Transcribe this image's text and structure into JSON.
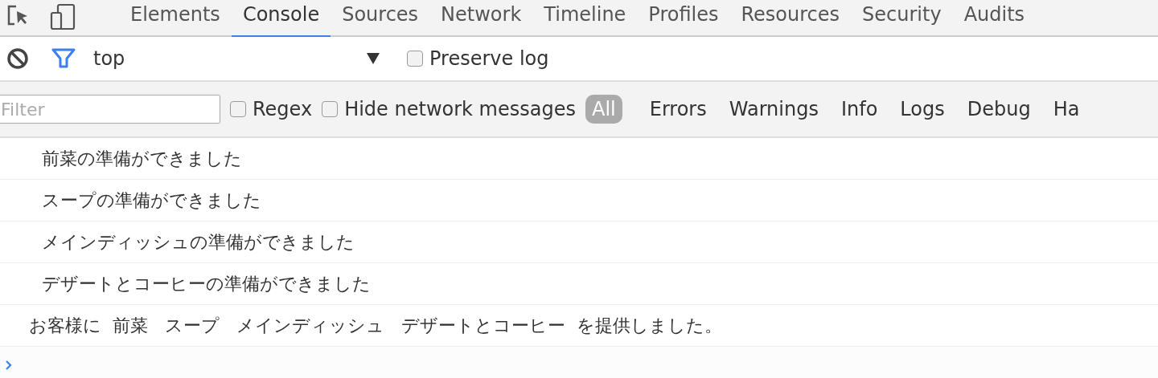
{
  "tabs": [
    {
      "label": "Elements",
      "selected": false
    },
    {
      "label": "Console",
      "selected": true
    },
    {
      "label": "Sources",
      "selected": false
    },
    {
      "label": "Network",
      "selected": false
    },
    {
      "label": "Timeline",
      "selected": false
    },
    {
      "label": "Profiles",
      "selected": false
    },
    {
      "label": "Resources",
      "selected": false
    },
    {
      "label": "Security",
      "selected": false
    },
    {
      "label": "Audits",
      "selected": false
    }
  ],
  "toolbar": {
    "context": "top",
    "preserve_log": {
      "label": "Preserve log",
      "checked": false
    }
  },
  "filter_bar": {
    "placeholder": "Filter",
    "regex": {
      "label": "Regex",
      "checked": false
    },
    "hide_network": {
      "label": "Hide network messages",
      "checked": false
    },
    "levels": [
      {
        "label": "All",
        "selected": true
      },
      {
        "label": "Errors",
        "selected": false
      },
      {
        "label": "Warnings",
        "selected": false
      },
      {
        "label": "Info",
        "selected": false
      },
      {
        "label": "Logs",
        "selected": false
      },
      {
        "label": "Debug",
        "selected": false
      },
      {
        "label": "Ha",
        "selected": false
      }
    ]
  },
  "messages": [
    {
      "text": "前菜の準備ができました",
      "kind": "indented"
    },
    {
      "text": "スープの準備ができました",
      "kind": "indented"
    },
    {
      "text": "メインディッシュの準備ができました",
      "kind": "indented"
    },
    {
      "text": "デザートとコーヒーの準備ができました",
      "kind": "indented"
    },
    {
      "text": "お客様に  前菜   スープ   メインディッシュ   デザートとコーヒー  を提供しました。",
      "kind": "plain"
    }
  ]
}
